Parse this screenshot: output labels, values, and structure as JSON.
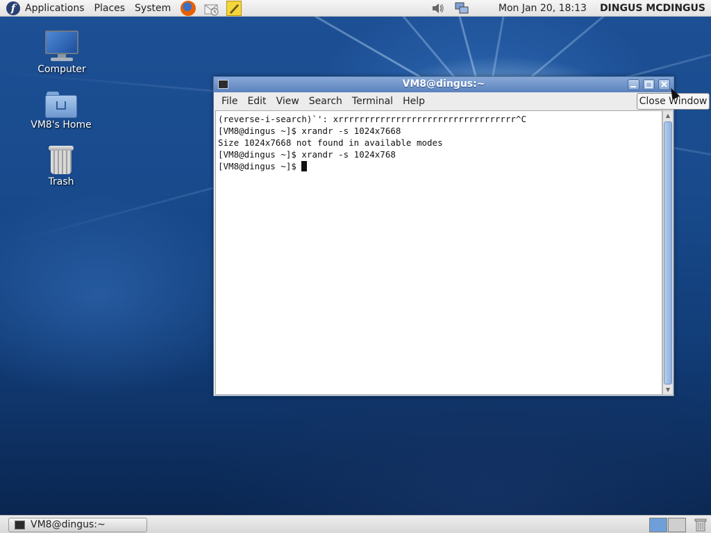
{
  "top_panel": {
    "menus": [
      "Applications",
      "Places",
      "System"
    ],
    "clock": "Mon Jan 20, 18:13",
    "user": "DINGUS MCDINGUS"
  },
  "desktop": {
    "icons": [
      {
        "label": "Computer"
      },
      {
        "label": "VM8's Home"
      },
      {
        "label": "Trash"
      }
    ]
  },
  "window": {
    "title": "VM8@dingus:~",
    "menu": [
      "File",
      "Edit",
      "View",
      "Search",
      "Terminal",
      "Help"
    ],
    "lines": [
      "(reverse-i-search)`': xrrrrrrrrrrrrrrrrrrrrrrrrrrrrrrrrrr^C",
      "[VM8@dingus ~]$ xrandr -s 1024x7668",
      "Size 1024x7668 not found in available modes",
      "[VM8@dingus ~]$ xrandr -s 1024x768",
      "[VM8@dingus ~]$ "
    ]
  },
  "tooltip": "Close Window",
  "taskbar": {
    "task_label": "VM8@dingus:~"
  },
  "colors": {
    "titlebar": "#5a82bd",
    "panel": "#e2e2e2",
    "desktop": "#184a8c"
  }
}
